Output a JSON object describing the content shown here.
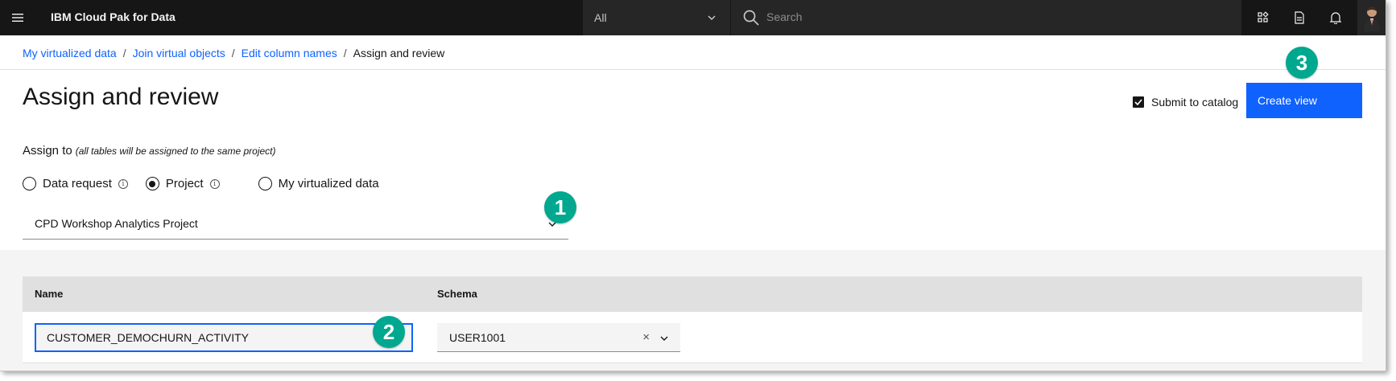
{
  "header": {
    "brand": "IBM Cloud Pak for Data",
    "scope_value": "All",
    "search_placeholder": "Search"
  },
  "breadcrumb": {
    "items": [
      "My virtualized data",
      "Join virtual objects",
      "Edit column names"
    ],
    "current": "Assign and review"
  },
  "page": {
    "title": "Assign and review",
    "submit_label": "Submit to catalog",
    "submit_checked": true,
    "create_label": "Create view"
  },
  "assign": {
    "label": "Assign to",
    "hint": "(all tables will be assigned to the same project)",
    "options": [
      "Data request",
      "Project",
      "My virtualized data"
    ],
    "selected": "Project",
    "project_value": "CPD Workshop Analytics Project"
  },
  "table": {
    "columns": [
      "Name",
      "Schema"
    ],
    "rows": [
      {
        "name": "CUSTOMER_DEMOCHURN_ACTIVITY",
        "schema": "USER1001"
      }
    ]
  },
  "callouts": [
    "1",
    "2",
    "3"
  ],
  "colors": {
    "accent": "#0f62fe",
    "callout": "#00a88f",
    "header": "#161616"
  },
  "icons": [
    "menu-icon",
    "chevron-down-icon",
    "search-icon",
    "apps-icon",
    "document-icon",
    "notification-icon",
    "user-avatar-icon",
    "info-icon",
    "checkmark-icon",
    "close-icon"
  ]
}
